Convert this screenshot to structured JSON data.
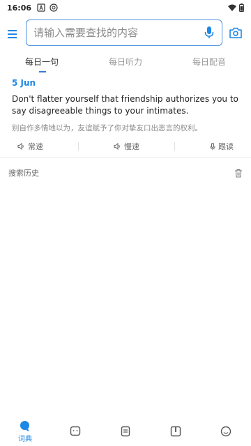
{
  "status": {
    "time": "16:06"
  },
  "search": {
    "placeholder": "请输入需要查找的内容"
  },
  "tabs": [
    {
      "label": "每日一句"
    },
    {
      "label": "每日听力"
    },
    {
      "label": "每日配音"
    }
  ],
  "daily": {
    "date": "5 Jun",
    "english": "Don't flatter yourself that friendship authorizes you to say disagreeable things to your intimates.",
    "chinese": "别自作多情地以为，友谊赋予了你对挚友口出恶言的权利。"
  },
  "actions": {
    "normal_speed": "常速",
    "slow_speed": "慢速",
    "follow_read": "跟读"
  },
  "history": {
    "title": "搜索历史"
  },
  "bottom_nav": {
    "dictionary_label": "词典"
  },
  "colors": {
    "accent": "#1e88e5",
    "search_border": "#4a90e2"
  }
}
